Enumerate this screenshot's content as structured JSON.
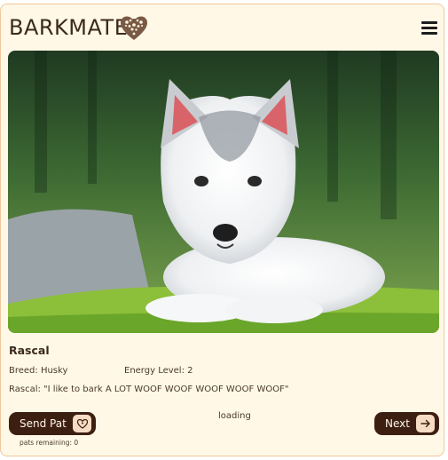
{
  "app": {
    "title": "BARKMATES"
  },
  "header": {
    "menu_icon": "hamburger-menu-icon",
    "logo_icon": "heart-paws-icon"
  },
  "profile": {
    "name": "Rascal",
    "breed": "Breed: Husky",
    "energy": "Energy Level: 2",
    "quote": "Rascal: \"I like to bark A LOT WOOF WOOF WOOF WOOF WOOF\""
  },
  "status": {
    "loading": "loading"
  },
  "actions": {
    "send_pat_label": "Send Pat",
    "next_label": "Next",
    "pats_remaining": "pats remaining: 0"
  },
  "colors": {
    "card_bg": "#fff8e7",
    "card_border": "#f1c79b",
    "button_bg": "#3d1f12",
    "button_icon_bg": "#f6dcc4"
  }
}
